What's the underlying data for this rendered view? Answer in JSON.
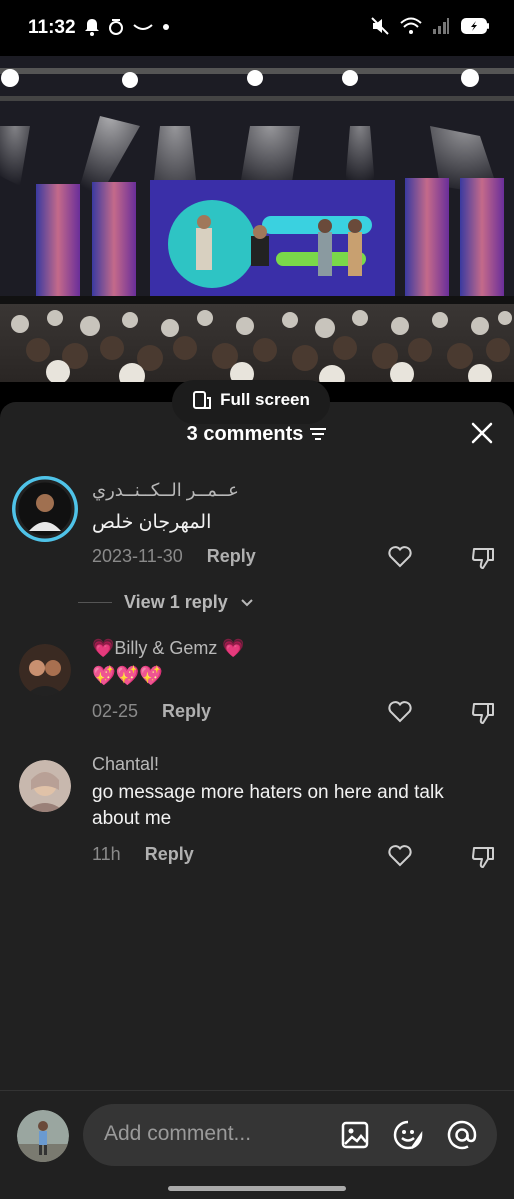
{
  "status_bar": {
    "time": "11:32",
    "icons": [
      "bell-icon",
      "alarm-icon",
      "cloud-icon",
      "dot-icon",
      "mute-icon",
      "wifi-icon",
      "signal-icon",
      "battery-icon"
    ]
  },
  "video": {
    "fullscreen_label": "Full screen"
  },
  "comments_panel": {
    "title": "3 comments",
    "comments": [
      {
        "username": "عــمــر الــكــنــدري",
        "text": "المهرجان خلص",
        "date": "2023-11-30",
        "reply_label": "Reply",
        "view_replies": "View 1 reply"
      },
      {
        "username": "💗Billy & Gemz 💗",
        "text": "💖💖💖",
        "date": "02-25",
        "reply_label": "Reply"
      },
      {
        "username": "Chantal!",
        "text": "go message more haters on here and talk about me",
        "date": "11h",
        "reply_label": "Reply"
      }
    ]
  },
  "composer": {
    "placeholder": "Add comment..."
  },
  "colors": {
    "sheet_bg": "#212121",
    "input_bg": "#353535",
    "avatar_ring": "#4fc3e8"
  }
}
